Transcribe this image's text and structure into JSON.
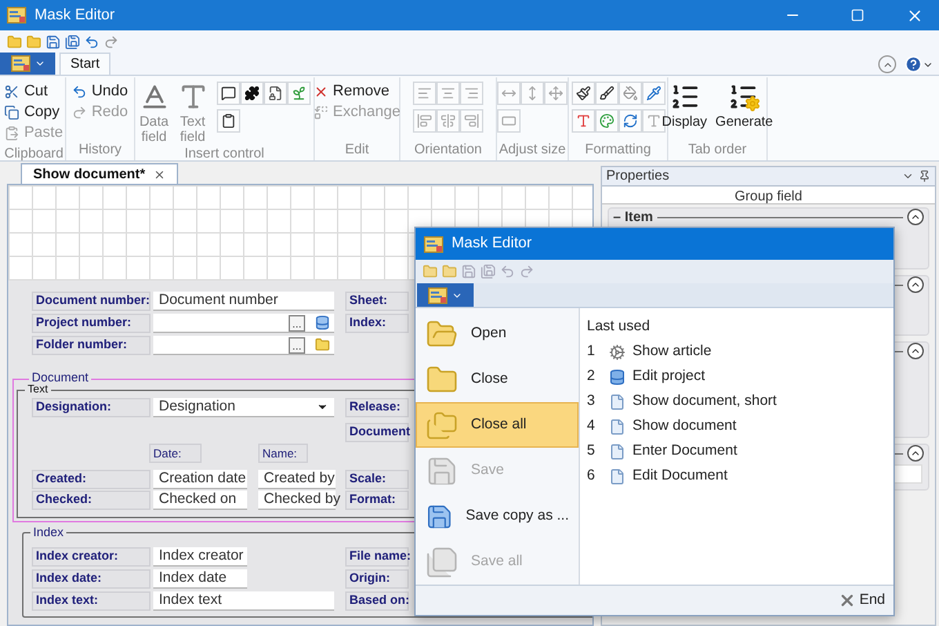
{
  "window": {
    "title": "Mask Editor"
  },
  "ribbon": {
    "tabs": [
      {
        "label": "Start",
        "selected": true
      }
    ],
    "groups": [
      {
        "label": "Clipboard",
        "items": [
          {
            "label": "Cut",
            "kind": "small",
            "disabled": false
          },
          {
            "label": "Copy",
            "kind": "small",
            "disabled": false
          },
          {
            "label": "Paste",
            "kind": "small",
            "disabled": true
          }
        ]
      },
      {
        "label": "History",
        "items": [
          {
            "label": "Undo",
            "kind": "small",
            "disabled": false
          },
          {
            "label": "Redo",
            "kind": "small",
            "disabled": true
          }
        ]
      },
      {
        "label": "Insert control",
        "items": [
          {
            "label": "Data field",
            "kind": "large",
            "disabled": true
          },
          {
            "label": "Text field",
            "kind": "large",
            "disabled": true
          }
        ]
      },
      {
        "label": "Edit",
        "items": [
          {
            "label": "Remove",
            "kind": "small",
            "disabled": false
          },
          {
            "label": "Exchange",
            "kind": "small",
            "disabled": true
          }
        ]
      },
      {
        "label": "Orientation"
      },
      {
        "label": "Adjust size"
      },
      {
        "label": "Formatting"
      },
      {
        "label": "Tab order",
        "items": [
          {
            "label": "Display",
            "kind": "large",
            "disabled": false
          },
          {
            "label": "Generate",
            "kind": "large",
            "disabled": false
          }
        ]
      }
    ]
  },
  "document_tab": {
    "label": "Show document*",
    "selected": true
  },
  "mask": {
    "rows": [
      {
        "label": "Document number:",
        "value": "Document number",
        "kind": "highlighted"
      },
      {
        "label": "Project number:",
        "browse": "...",
        "kind": "project"
      },
      {
        "label": "Folder number:",
        "browse": "...",
        "kind": "folder"
      }
    ],
    "side_labels": [
      "Sheet:",
      "Index:"
    ],
    "document_group": {
      "legend": "Document",
      "text_legend": "Text",
      "designation": {
        "label": "Designation:",
        "value": "Designation"
      },
      "right_labels": [
        "Release:",
        "Document"
      ],
      "column_headers": [
        "Date:",
        "Name:"
      ],
      "rows": [
        {
          "label": "Created:",
          "date": "Creation date",
          "name": "Created by",
          "right": "Scale:"
        },
        {
          "label": "Checked:",
          "date": "Checked on",
          "name": "Checked by",
          "right": "Format:"
        }
      ]
    },
    "index_group": {
      "legend": "Index",
      "rows": [
        {
          "label": "Index creator:",
          "value": "Index creator",
          "right": "File name:",
          "kind": "short"
        },
        {
          "label": "Index date:",
          "value": "Index date",
          "right": "Origin:",
          "kind": "short"
        },
        {
          "label": "Index text:",
          "value": "Index text",
          "right": "Based on:",
          "kind": "long"
        }
      ]
    }
  },
  "properties": {
    "title": "Properties",
    "subtitle": "Group field",
    "sections": [
      {
        "title": "– Item",
        "expanded": true
      },
      {
        "expanded": true
      },
      {
        "expanded": true
      },
      {
        "expanded": true
      }
    ]
  },
  "dialog": {
    "title": "Mask Editor",
    "commands": [
      {
        "label": "Open",
        "disabled": false,
        "selected": false
      },
      {
        "label": "Close",
        "disabled": false,
        "selected": false
      },
      {
        "label": "Close all",
        "disabled": false,
        "selected": true
      },
      {
        "label": "Save",
        "disabled": true,
        "selected": false
      },
      {
        "label": "Save copy as ...",
        "disabled": false,
        "selected": false
      },
      {
        "label": "Save all",
        "disabled": true,
        "selected": false
      }
    ],
    "recent_title": "Last used",
    "recent": [
      {
        "number": "1",
        "label": "Show article",
        "kind": "article"
      },
      {
        "number": "2",
        "label": "Edit project",
        "kind": "project"
      },
      {
        "number": "3",
        "label": "Show document, short",
        "kind": "document"
      },
      {
        "number": "4",
        "label": "Show document",
        "kind": "document"
      },
      {
        "number": "5",
        "label": "Enter Document",
        "kind": "document"
      },
      {
        "number": "6",
        "label": "Edit Document",
        "kind": "document"
      }
    ],
    "end_button": "End"
  }
}
